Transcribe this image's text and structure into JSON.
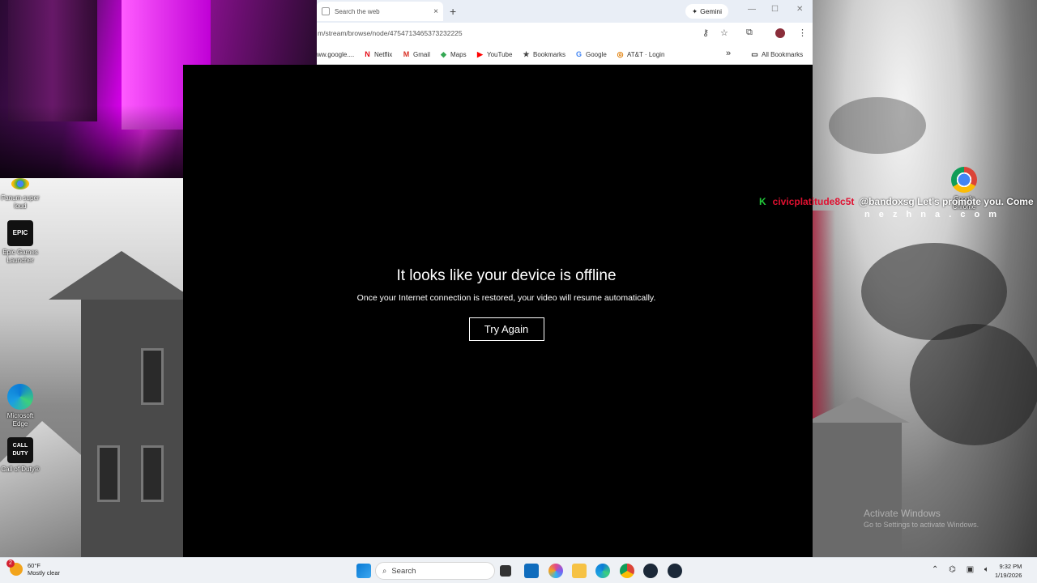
{
  "browser": {
    "tab_title": "Search the web",
    "tab_close": "×",
    "new_tab": "+",
    "gemini_label": "Gemini",
    "url": "m/stream/browse/node/475471346537323222​5",
    "window_controls": {
      "minimize": "—",
      "maximize": "☐",
      "close": "✕"
    },
    "bookmarks": [
      {
        "label": "ww.google....",
        "icon": ""
      },
      {
        "label": "Netflix",
        "icon": "N",
        "color": "#e50914"
      },
      {
        "label": "Gmail",
        "icon": "M",
        "color": "#d93025"
      },
      {
        "label": "Maps",
        "icon": "◆",
        "color": "#34a853"
      },
      {
        "label": "YouTube",
        "icon": "▶",
        "color": "#ff0000"
      },
      {
        "label": "Bookmarks",
        "icon": "★",
        "color": "#444"
      },
      {
        "label": "Google",
        "icon": "G",
        "color": "#4285f4"
      },
      {
        "label": "AT&T · Login",
        "icon": "◎",
        "color": "#e07b00"
      }
    ],
    "bookmarks_overflow": "»",
    "all_bookmarks": "All Bookmarks"
  },
  "video": {
    "heading": "It looks like your device is offline",
    "message": "Once your Internet connection is restored, your video will resume automatically.",
    "try_again": "Try Again"
  },
  "chat": {
    "badge": "K",
    "username": "civicplatitude8c5t",
    "message": "@bandoxsg Let's promote you. Come",
    "message_line2": "n e z h n a . c o m"
  },
  "desktop_icons": [
    {
      "label": "Fanum super loud",
      "icon": "chrome-shortcut-icon"
    },
    {
      "label": "Epic Games Launcher",
      "icon": "epic-games-icon"
    },
    {
      "label": "Microsoft Edge",
      "icon": "edge-icon"
    },
    {
      "label": "Call of Duty®",
      "icon": "call-of-duty-icon"
    },
    {
      "label": "Google Chrome",
      "icon": "chrome-icon"
    }
  ],
  "watermark": {
    "title": "Activate Windows",
    "subtitle": "Go to Settings to activate Windows."
  },
  "taskbar": {
    "weather_temp": "60°F",
    "weather_desc": "Mostly clear",
    "weather_badge": "2",
    "search_placeholder": "Search",
    "time": "9:32 PM",
    "date": "1/19/2026"
  }
}
